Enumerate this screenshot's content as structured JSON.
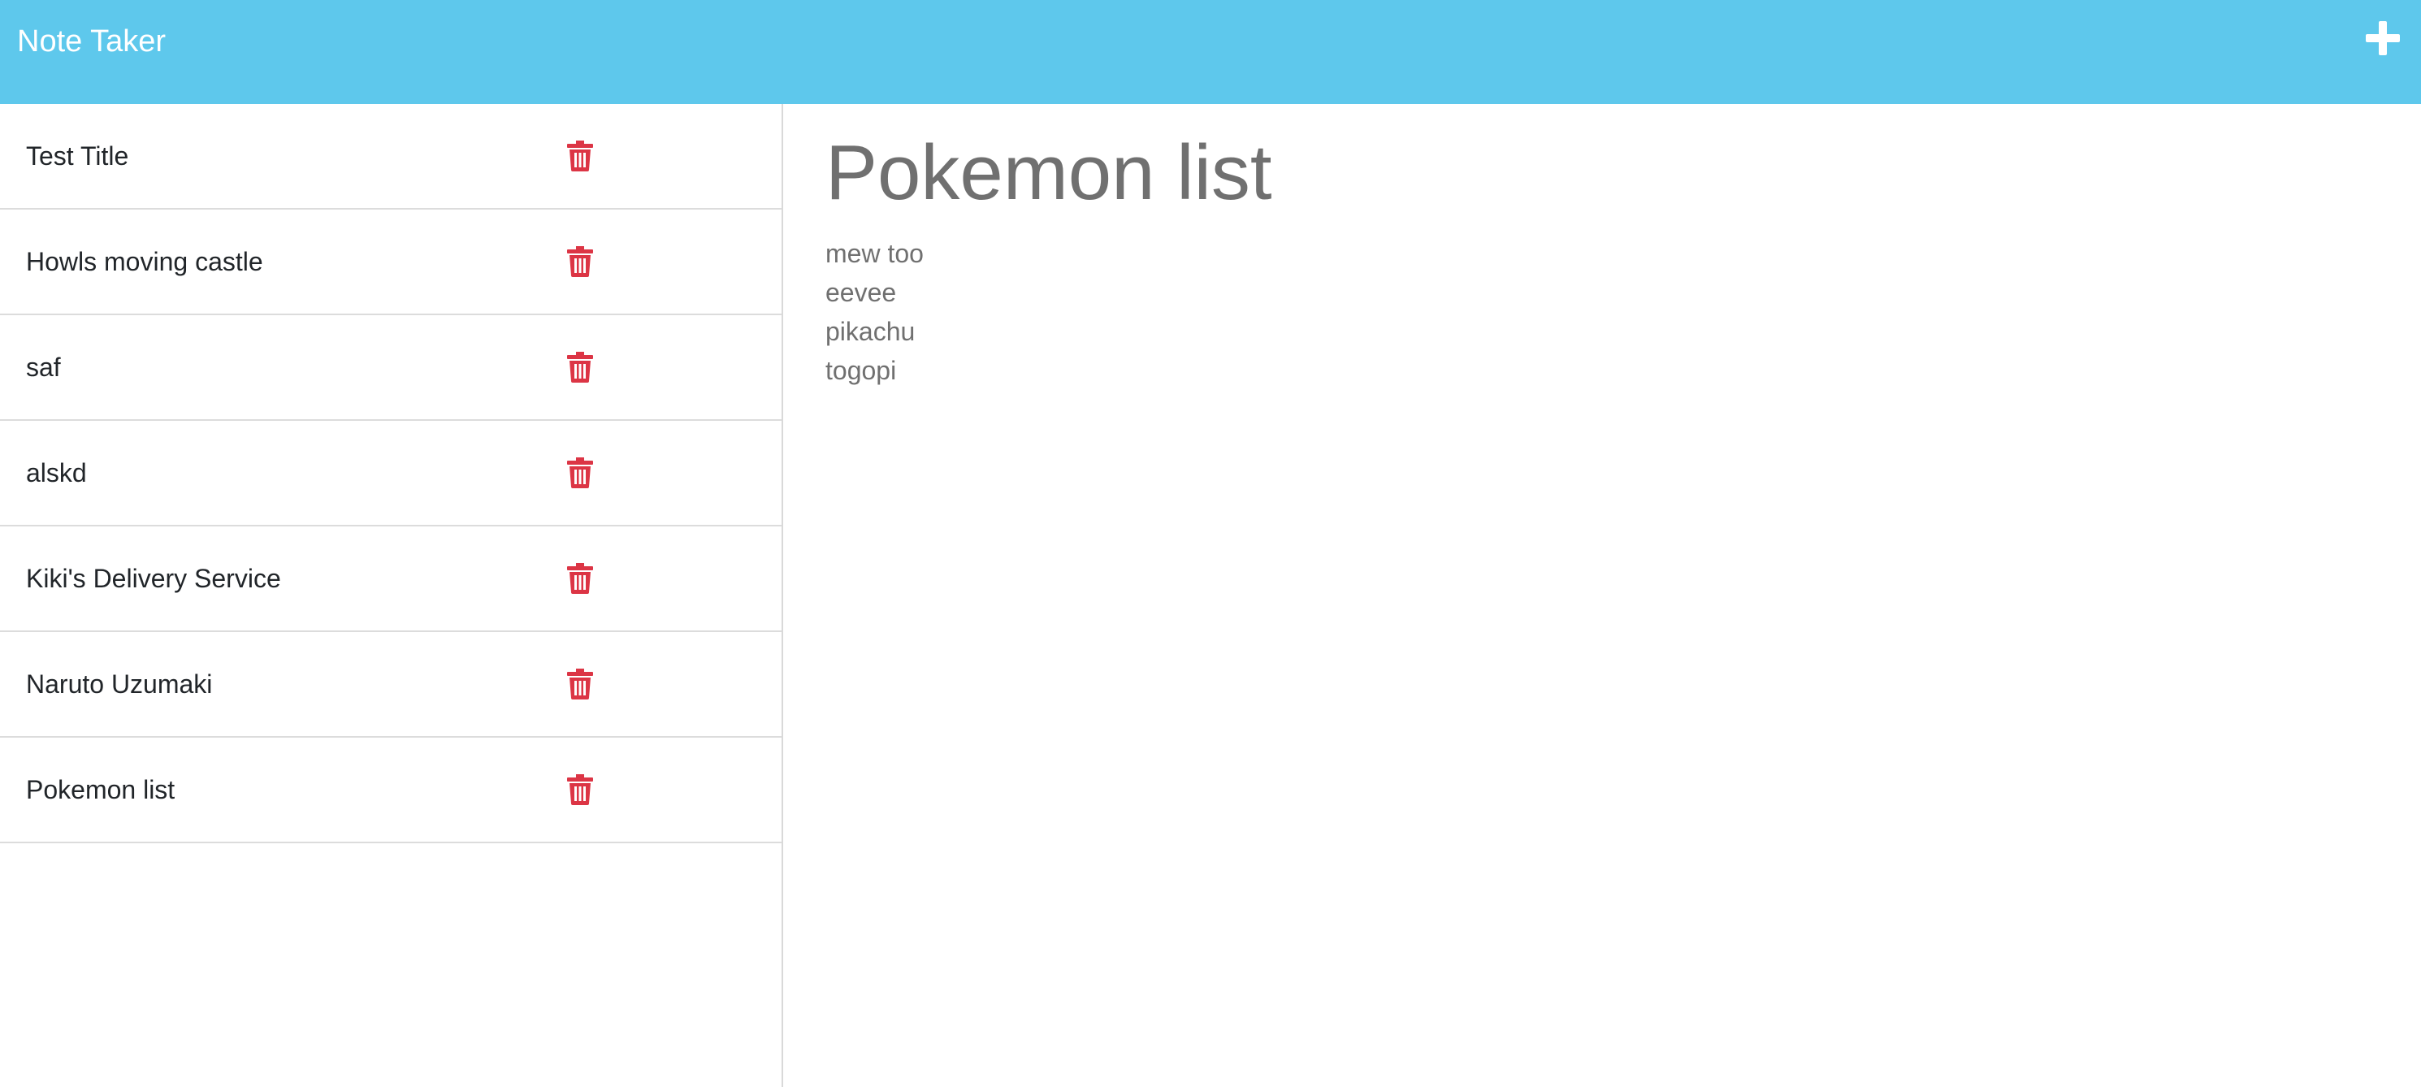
{
  "app": {
    "title": "Note Taker"
  },
  "toolbar": {
    "new_note_icon": "plus-icon"
  },
  "notes": [
    {
      "title": "Test Title"
    },
    {
      "title": "Howls moving castle"
    },
    {
      "title": "saf"
    },
    {
      "title": "alskd"
    },
    {
      "title": "Kiki's Delivery Service"
    },
    {
      "title": "Naruto Uzumaki"
    },
    {
      "title": "Pokemon list"
    }
  ],
  "active_note": {
    "title": "Pokemon list",
    "lines": [
      "mew too",
      "eevee",
      "pikachu",
      "togopi"
    ]
  },
  "colors": {
    "navbar": "#5ec8ec",
    "delete_icon": "#dc3545",
    "note_text": "#707070"
  }
}
